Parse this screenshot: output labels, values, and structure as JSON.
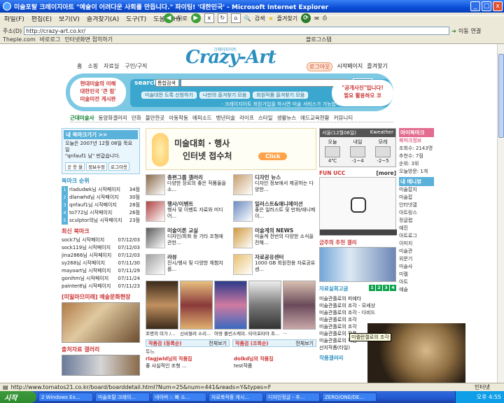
{
  "window": {
    "title": "미술포탈 크레이지아트 \"예술이 어려다운 사회를 만듭니다.\" 파이팅! '대한민국' - Microsoft Internet Explorer",
    "min": "_",
    "max": "□",
    "close": "x"
  },
  "menu": [
    "파일(F)",
    "편집(E)",
    "보기(V)",
    "즐겨찾기(A)",
    "도구(T)",
    "도움말(H)"
  ],
  "toolbar": {
    "back": "뒤로",
    "search": "검색",
    "favorites": "즐겨찾기"
  },
  "address": {
    "label": "주소(D)",
    "url": "http://crazy-art.co.kr/",
    "go": "이동",
    "links": "연결"
  },
  "linksbar": [
    "Theple.com",
    "바로로그",
    "인터넷화면 접히하기",
    "블로그스템"
  ],
  "site": {
    "topnav": [
      "홈",
      "소핑",
      "자료실",
      "구인/구직"
    ],
    "logo": "Crazy-Art",
    "logo_sub": "크레이지아트",
    "rightnav": [
      "로그아웃",
      "시작페이지",
      "즐겨찾기"
    ],
    "search_left": [
      "현대미술의 이해",
      "대한민국 '큰 힘'",
      "미술미전 게시판"
    ],
    "search_label": "search",
    "search_select": "통합검색",
    "search_btn": "검색",
    "chips": [
      "미술대전 도록 신청하기",
      "나만의 즐겨찾기 모음",
      "회원작품 즐겨찾기 모음"
    ],
    "notice": "- 크레이지아트 회원가입을 하시면 미술 서비스가 가능합니다.",
    "search_right": [
      "\"공개사진\"입니다!",
      "필요 활용하오 코"
    ],
    "categories": [
      "근대미술사",
      "동양화갤러리",
      "만화",
      "불만한곳",
      "아동학동",
      "에피소드",
      "뱅년미술",
      "라이프",
      "스타일",
      "생활뉴스",
      "애드교육현황",
      "커뮤니티"
    ]
  },
  "left": {
    "mypage_head": "내 북마크가기 >>",
    "mypage_text": [
      "오늘은 2007년 12월 08일 목요일",
      "\"qnfauf1 님\" 반갑습니다."
    ],
    "mypage_btns": [
      "곳 웃 을",
      "정보수정",
      "로그아웃"
    ],
    "rank_title": "북마크 순위",
    "ranks": [
      {
        "n": "1",
        "name": "rladudwk님 시작페이지",
        "score": "34점"
      },
      {
        "n": "2",
        "name": "dlanwhd님 시작페이지",
        "score": "30점"
      },
      {
        "n": "3",
        "name": "qnfauf1님 시작페이지",
        "score": "28점"
      },
      {
        "n": "4",
        "name": "to772님 시작페이지",
        "score": "26점"
      },
      {
        "n": "5",
        "name": "sculptor의님 시작페이지",
        "score": "23점"
      }
    ],
    "latest_title": "최신 북마크",
    "latest": [
      {
        "name": "sock7님 시작페이지",
        "date": "07/12/03"
      },
      {
        "name": "sock119님 시작페이지",
        "date": "07/12/03"
      },
      {
        "name": "jina2866님 시작페이지",
        "date": "07/12/03"
      },
      {
        "name": "sy268님 시작페이지",
        "date": "07/11/30"
      },
      {
        "name": "mayoart님 시작페이지",
        "date": "07/11/29"
      },
      {
        "name": "gonihm님 시작페이지",
        "date": "07/11/24"
      },
      {
        "name": "painter8님 시작페이지",
        "date": "07/11/23"
      }
    ],
    "event_title": "[미읾마므미래] 예술문화현장",
    "gallery_title": "출처자료 갤러리"
  },
  "center": {
    "banner_1": "미술대회 · 행사",
    "banner_2": "인터넷 접수처",
    "banner_click": "Click",
    "items": [
      {
        "title": "종편그룹 갤러리",
        "desc": "다양한 장르의 좋은 작품들을 소..."
      },
      {
        "title": "디자인 뉴스",
        "desc": "디자인 정보에서 제공하는 다양한..."
      },
      {
        "title": "행사/이벤트",
        "desc": "행사 및 이벤트 자료와 미디어..."
      },
      {
        "title": "일러스트&애니메이션",
        "desc": "좋은 일러스트 및 만화/애니메이..."
      },
      {
        "title": "미술이론 교실",
        "desc": "디자인/회화 등 기타 조형에 관한..."
      },
      {
        "title": "미술계의 NEWS",
        "desc": "미술계 전반의 다양한 소식을 전해..."
      },
      {
        "title": "라뷰",
        "desc": "전시/행사 및 다양한 체험지를..."
      },
      {
        "title": "자료공유센터",
        "desc": "1000 GB 회원전용 자료공유센..."
      }
    ],
    "captions": [
      "조명의 미가 /...",
      "신비혈려 소리...",
      "여영 풀빈스케미...",
      "타이포타야 조...",
      "..."
    ],
    "tab_left": "작품검 (등록순)",
    "tab_left_more": "전체보기",
    "tab_right": "작품검 (조회순)",
    "tab_right_more": "전체보기",
    "list_left": [
      "두느",
      "rlagjwld님의 작품집",
      "좋 사실적인 조형 ..."
    ],
    "list_right": [
      "dolkd님의 작품집",
      "test작품"
    ]
  },
  "ucc": {
    "weather_head": "서울(12월06일)",
    "weather_brand": "Kweather",
    "days": [
      {
        "label": "오늘",
        "temp": "4℃"
      },
      {
        "label": "내일",
        "temp": "-1~4"
      },
      {
        "label": "모레",
        "temp": "-2~5"
      }
    ],
    "fun_title": "FUN UCC",
    "fun_more": "[more]",
    "recommend_title": "금주의 추천 갤리",
    "data_title": "자료실회고글",
    "pages": [
      "1",
      "2",
      "3",
      "4"
    ],
    "list": [
      "미술관플로의 피에타",
      "미술관플로의 조각 - 모세상",
      "미술관플로의 조각 - 다비드",
      "미술관플로의 조각",
      "미술관플로의 조각",
      "미술관플로의 작품",
      "미술관플로의 작품",
      "선지작품(타일)"
    ],
    "gallery_title": "작품갤러리",
    "tooltip": "미켈란젤로의 조각"
  },
  "right": {
    "head": "마이북마크",
    "sub": "북마크정보",
    "stats": [
      "조회수: 2143명",
      "추천수: 7점",
      "순위: 3위",
      "오늘방문: 1개"
    ],
    "my_title": "내 메니뷰",
    "links": [
      "미술잡지",
      "미술잡",
      "인터넷갤",
      "아트링스",
      "정글랩",
      "예진",
      "아트로그",
      "이미지",
      "미술관",
      "외문기",
      "미술사",
      "미켈",
      "아트",
      "예술"
    ]
  },
  "status": {
    "url": "http://www.tomatos21.co.kr/board/boarddetail.html?Num=25&num=441&reads=Y&types=F",
    "zone": "인터넷"
  },
  "taskbar": {
    "start": "시작",
    "tasks": [
      "2 Windows Ex...",
      "미술포탈 크레이...",
      "네이버 :: 빠 소...",
      "자료축적중 게시...",
      "디자인정글 - 추...",
      "ZERO/ONE/DE..."
    ],
    "clock": "오후 4:55"
  },
  "colors": {
    "accent": "#2b8fbf",
    "title_bar": "#0a4ed8",
    "pink": "#e26b8f"
  }
}
